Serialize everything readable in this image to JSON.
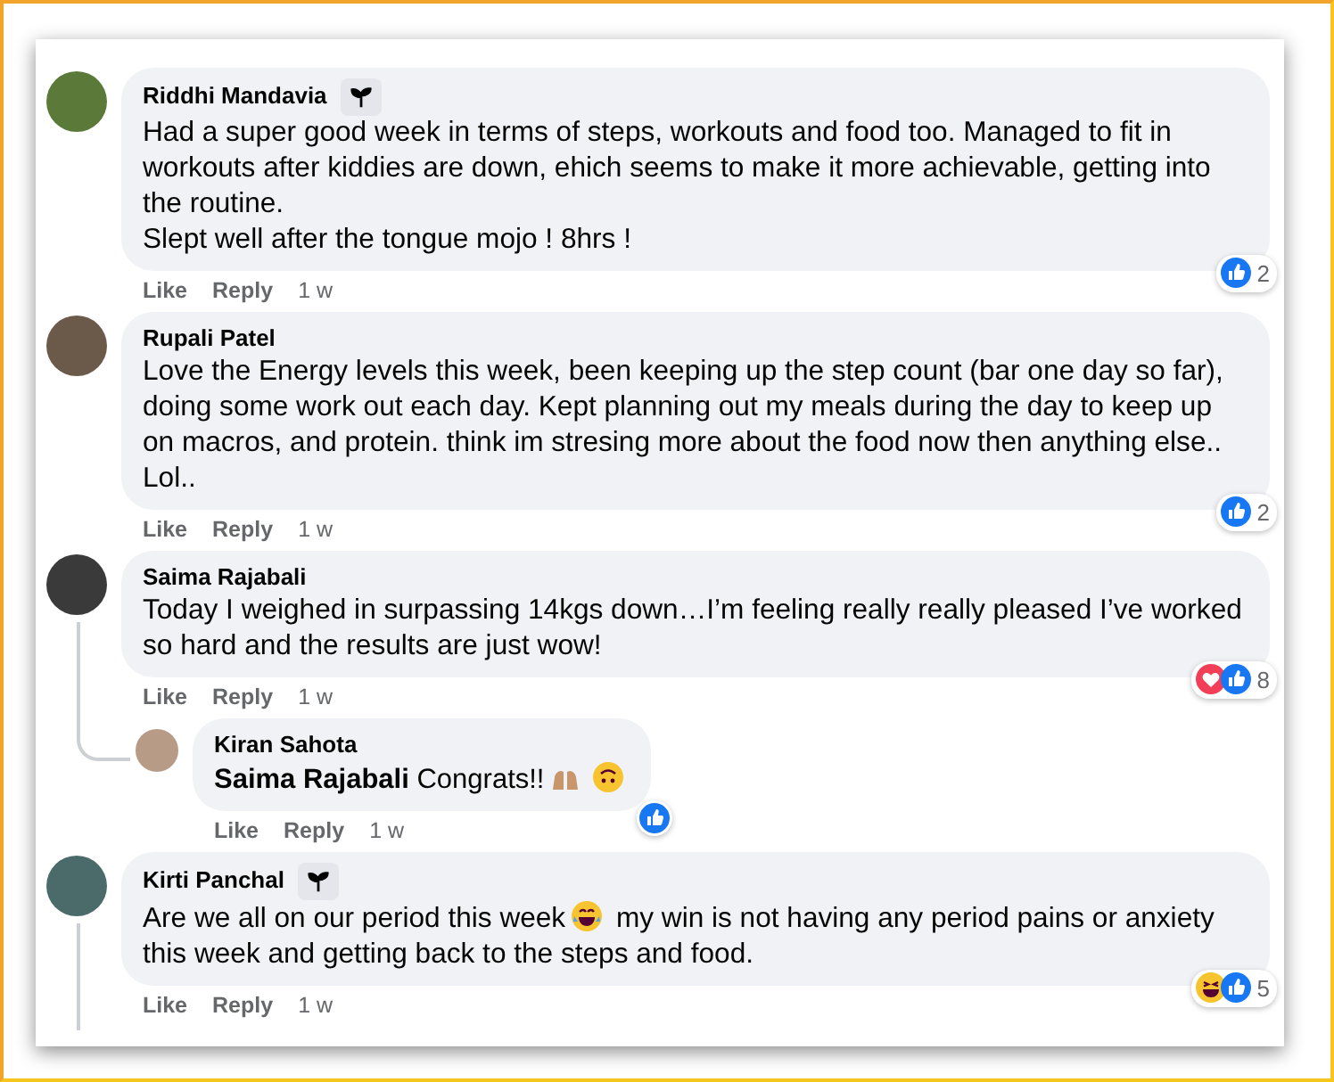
{
  "comments": [
    {
      "author": "Riddhi Mandavia",
      "badge": true,
      "reply": false,
      "body": [
        {
          "kind": "text",
          "text": "Had a super good week in terms of steps, workouts and food too. Managed to fit in workouts after kiddies are down, ehich seems to make it more achievable, getting into the routine.\nSlept well after the tongue mojo ! 8hrs !"
        }
      ],
      "reactions": [
        {
          "kind": "like"
        }
      ],
      "reaction_count": "2",
      "actions": [
        "Like",
        "Reply"
      ],
      "time": "1 w",
      "thread": false
    },
    {
      "author": "Rupali Patel",
      "badge": false,
      "reply": false,
      "body": [
        {
          "kind": "text",
          "text": "Love the Energy levels this week, been keeping up the step count (bar one day so far), doing some work out each day. Kept planning out my meals during the day to keep up on macros, and protein. think im stresing more about the food now then anything else.. Lol.."
        }
      ],
      "reactions": [
        {
          "kind": "like"
        }
      ],
      "reaction_count": "2",
      "actions": [
        "Like",
        "Reply"
      ],
      "time": "1 w",
      "thread": false
    },
    {
      "author": "Saima Rajabali",
      "badge": false,
      "reply": false,
      "body": [
        {
          "kind": "text",
          "text": "Today I weighed in surpassing 14kgs down…I’m feeling really really pleased I’ve worked so hard and the results are just wow!"
        }
      ],
      "reactions": [
        {
          "kind": "love"
        },
        {
          "kind": "like"
        }
      ],
      "reaction_count": "8",
      "actions": [
        "Like",
        "Reply"
      ],
      "time": "1 w",
      "thread": true
    },
    {
      "author": "Kiran Sahota",
      "badge": false,
      "reply": true,
      "body": [
        {
          "kind": "text",
          "text": "**Saima Rajabali** Congrats!!"
        },
        {
          "kind": "raised-hands"
        },
        {
          "kind": "upside-down"
        }
      ],
      "reactions": [
        {
          "kind": "like"
        }
      ],
      "actions": [
        "Like",
        "Reply"
      ],
      "time": "1 w",
      "thread": false
    },
    {
      "author": "Kirti Panchal",
      "badge": true,
      "reply": false,
      "body": [
        {
          "kind": "text",
          "text": "Are we all on our period this week"
        },
        {
          "kind": "laugh"
        },
        {
          "kind": "text",
          "text": "my win is not having any period pains or anxiety this week and getting back to the steps and food."
        }
      ],
      "reactions": [
        {
          "kind": "haha"
        },
        {
          "kind": "like"
        }
      ],
      "reaction_count": "5",
      "actions": [
        "Like",
        "Reply"
      ],
      "time": "1 w",
      "thread": true
    }
  ]
}
